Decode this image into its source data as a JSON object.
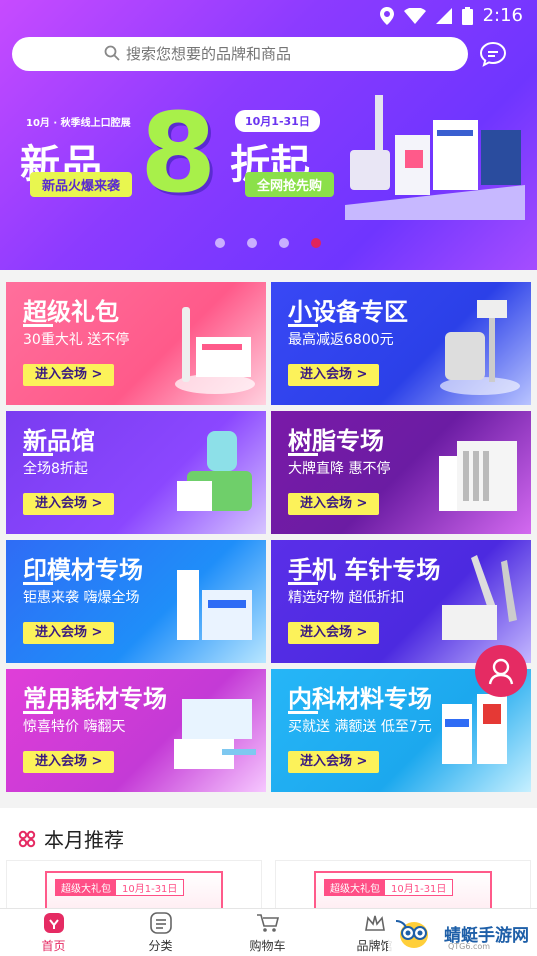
{
  "status_bar": {
    "time": "2:16"
  },
  "search": {
    "placeholder": "搜索您想要的品牌和商品"
  },
  "banner": {
    "small_text": "10月 · 秋季线上口腔展",
    "main_left": "新品",
    "big_number": "8",
    "main_right": "折起",
    "date": "10月1-31日",
    "tag_left": "新品火爆来袭",
    "tag_right": "全网抢先购",
    "dots_total": 4,
    "active_dot": 4
  },
  "cards": [
    {
      "title": "超级礼包",
      "subtitle": "30重大礼 送不停",
      "button": "进入会场 >"
    },
    {
      "title": "小设备专区",
      "subtitle": "最高减返6800元",
      "button": "进入会场 >"
    },
    {
      "title": "新品馆",
      "subtitle": "全场8折起",
      "button": "进入会场 >"
    },
    {
      "title": "树脂专场",
      "subtitle": "大牌直降 惠不停",
      "button": "进入会场 >"
    },
    {
      "title": "印模材专场",
      "subtitle": "钜惠来袭 嗨爆全场",
      "button": "进入会场 >"
    },
    {
      "title": "手机 车针专场",
      "subtitle": "精选好物 超低折扣",
      "button": "进入会场 >"
    },
    {
      "title": "常用耗材专场",
      "subtitle": "惊喜特价 嗨翻天",
      "button": "进入会场 >"
    },
    {
      "title": "内科材料专场",
      "subtitle": "买就送 满额送 低至7元",
      "button": "进入会场 >"
    }
  ],
  "recommend": {
    "title": "本月推荐",
    "items": [
      {
        "badge": "超级大礼包",
        "date": "10月1-31日"
      },
      {
        "badge": "超级大礼包",
        "date": "10月1-31日"
      }
    ]
  },
  "nav": [
    {
      "label": "首页",
      "icon": "home-icon",
      "active": true
    },
    {
      "label": "分类",
      "icon": "category-icon"
    },
    {
      "label": "购物车",
      "icon": "cart-icon"
    },
    {
      "label": "品牌馆",
      "icon": "brand-icon"
    }
  ],
  "watermark": {
    "text": "蜻蜓手游网",
    "sub": "QTG6.com"
  },
  "colors": {
    "accent": "#e52b63",
    "button_yellow": "#fcf25a"
  }
}
